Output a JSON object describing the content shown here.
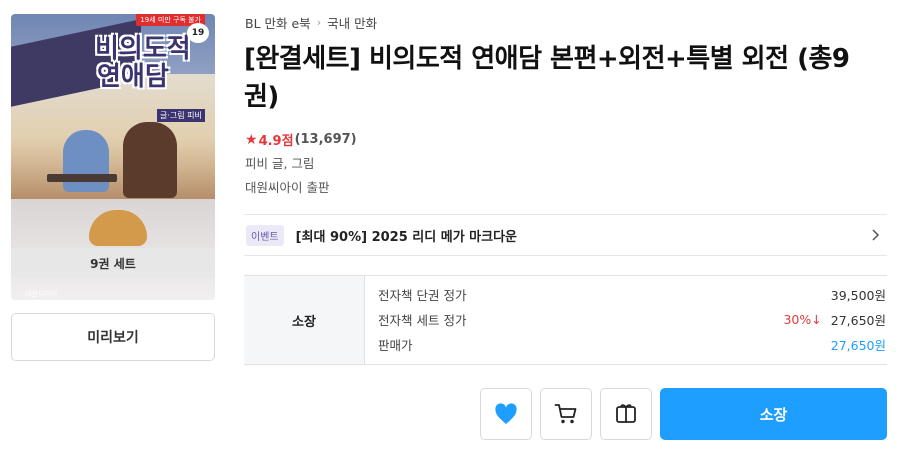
{
  "cover": {
    "title_line1": "비의도적",
    "title_line2": "연애담",
    "author_tag": "글·그림 피비",
    "age_tag": "19세 미만 구독 불가",
    "volume_badge": "19",
    "publisher_logo": "대원씨아이",
    "set_label": "9권 세트"
  },
  "preview_button": "미리보기",
  "breadcrumb": {
    "items": [
      "BL 만화 e북",
      "국내 만화"
    ],
    "separator": "›"
  },
  "product": {
    "title": "[완결세트] 비의도적 연애담 본편+외전+특별 외전 (총9권)",
    "rating_star": "★",
    "rating_score": "4.9점",
    "rating_count": "(13,697)",
    "author": "피비 글, 그림",
    "publisher": "대원씨아이 출판"
  },
  "event": {
    "badge": "이벤트",
    "text": "[최대 90%] 2025 리디 메가 마크다운"
  },
  "pricing": {
    "section_label": "소장",
    "rows": [
      {
        "label": "전자책 단권 정가",
        "value": "39,500원"
      },
      {
        "label": "전자책 세트 정가",
        "discount": "30%↓",
        "value": "27,650원"
      },
      {
        "label": "판매가",
        "value": "27,650원"
      }
    ]
  },
  "actions": {
    "wishlist_icon": "heart-icon",
    "cart_icon": "cart-icon",
    "gift_icon": "gift-icon",
    "primary_label": "소장"
  },
  "colors": {
    "accent": "#1e9eff",
    "rating": "#e3393b",
    "discount": "#e3393b",
    "event_badge_bg": "#ebe9f7"
  }
}
